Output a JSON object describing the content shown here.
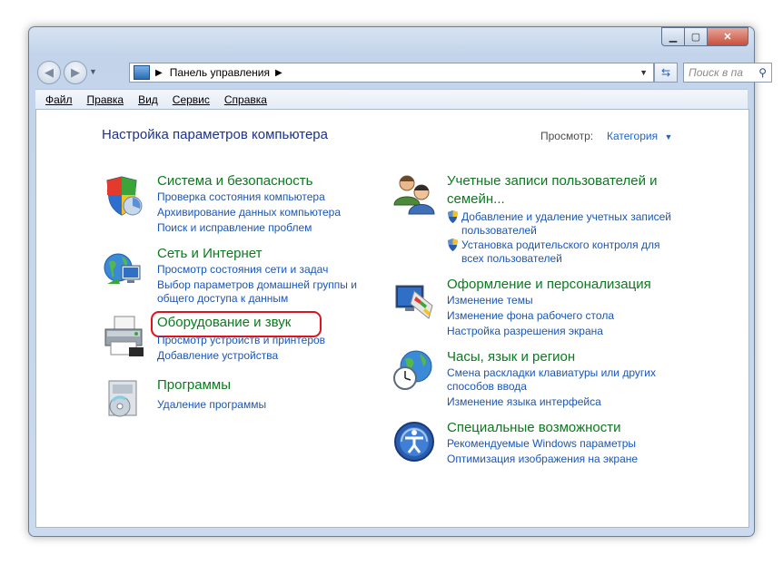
{
  "window": {
    "minimize_icon": "minimize-icon",
    "maximize_icon": "maximize-icon",
    "close_icon": "close-icon"
  },
  "address": {
    "path": "Панель управления",
    "search_placeholder": "Поиск в па"
  },
  "menu": {
    "file": "Файл",
    "edit": "Правка",
    "view": "Вид",
    "service": "Сервис",
    "help": "Справка"
  },
  "page": {
    "heading": "Настройка параметров компьютера",
    "view_label": "Просмотр:",
    "view_value": "Категория"
  },
  "left": [
    {
      "title": "Система и безопасность",
      "links": [
        "Проверка состояния компьютера",
        "Архивирование данных компьютера",
        "Поиск и исправление проблем"
      ]
    },
    {
      "title": "Сеть и Интернет",
      "links": [
        "Просмотр состояния сети и задач",
        "Выбор параметров домашней группы и",
        "общего доступа к данным"
      ]
    },
    {
      "title": "Оборудование и звук",
      "links": [
        "Просмотр устройств и принтеров",
        "Добавление устройства"
      ]
    },
    {
      "title": "Программы",
      "links": [
        "Удаление программы"
      ]
    }
  ],
  "right": [
    {
      "title_line1": "Учетные записи пользователей и",
      "title_line2": "семейн...",
      "links": [
        "Добавление и удаление учетных записей",
        "пользователей",
        "Установка родительского контроля для",
        "всех пользователей"
      ]
    },
    {
      "title": "Оформление и персонализация",
      "links": [
        "Изменение темы",
        "Изменение фона рабочего стола",
        "Настройка разрешения экрана"
      ]
    },
    {
      "title": "Часы, язык и регион",
      "links": [
        "Смена раскладки клавиатуры или других",
        "способов ввода",
        "Изменение языка интерфейса"
      ]
    },
    {
      "title": "Специальные возможности",
      "links": [
        "Рекомендуемые Windows параметры",
        "Оптимизация изображения на экране"
      ]
    }
  ],
  "colors": {
    "category_title": "#0a7a1e",
    "link": "#1a56b6",
    "heading": "#1e3287",
    "highlight": "#e0121d"
  }
}
